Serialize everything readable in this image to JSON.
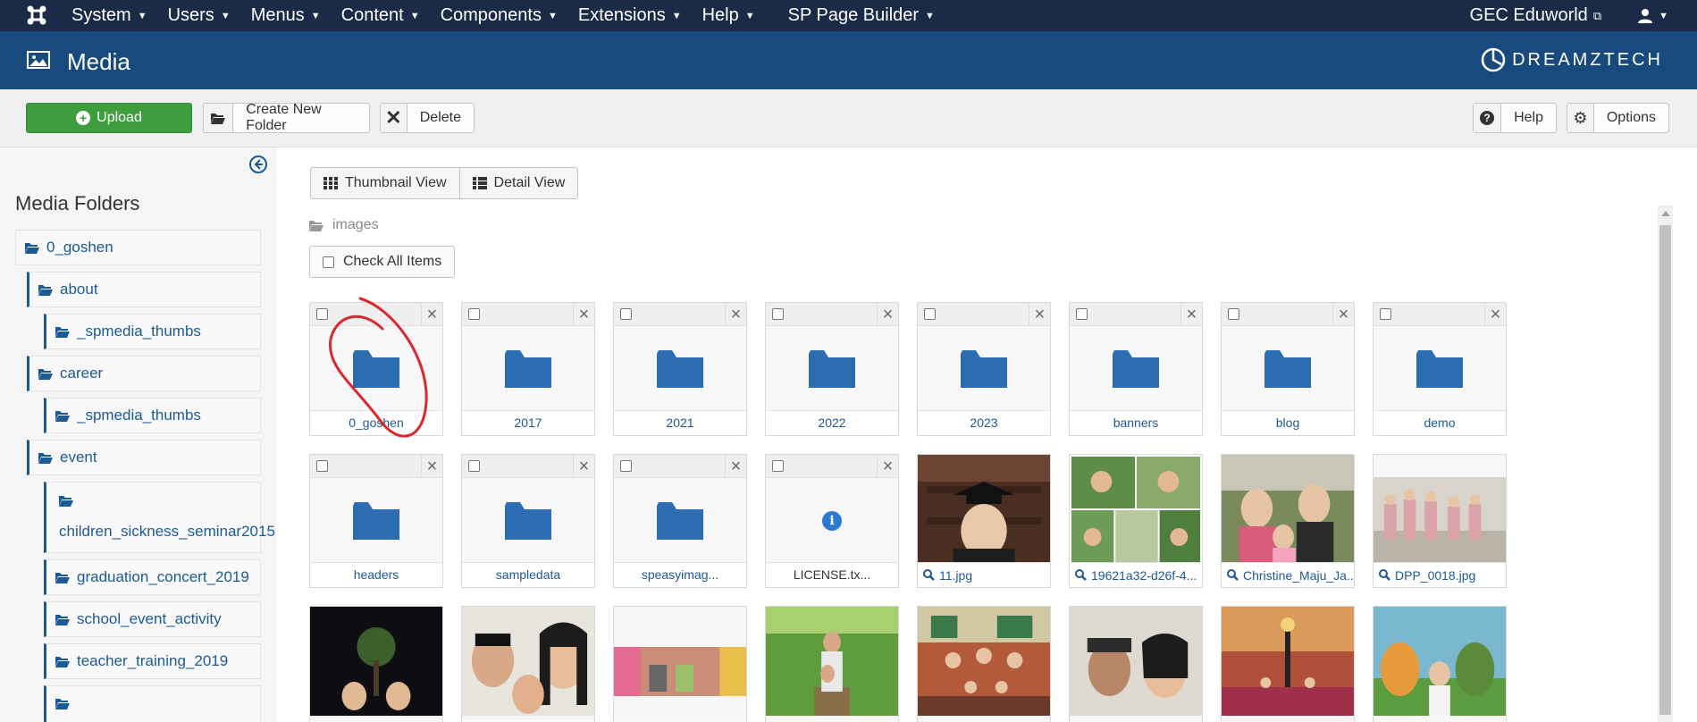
{
  "topnav": {
    "menu": [
      "System",
      "Users",
      "Menus",
      "Content",
      "Components",
      "Extensions",
      "Help"
    ],
    "sp_page_builder": "SP Page Builder",
    "site_name": "GEC Eduworld",
    "user_icon": "user-icon"
  },
  "header": {
    "title": "Media",
    "brand": "DREAMZTECH"
  },
  "toolbar": {
    "upload": "Upload",
    "create_folder": "Create New Folder",
    "delete": "Delete",
    "help": "Help",
    "options": "Options"
  },
  "sidebar": {
    "title": "Media Folders",
    "folders": [
      {
        "label": "0_goshen",
        "level": 0
      },
      {
        "label": "about",
        "level": 1
      },
      {
        "label": "_spmedia_thumbs",
        "level": 2
      },
      {
        "label": "career",
        "level": 1
      },
      {
        "label": "_spmedia_thumbs",
        "level": 2
      },
      {
        "label": "event",
        "level": 1
      },
      {
        "label": "children_sickness_seminar2015",
        "level": 2
      },
      {
        "label": "graduation_concert_2019",
        "level": 2
      },
      {
        "label": "school_event_activity",
        "level": 2
      },
      {
        "label": "teacher_training_2019",
        "level": 2
      },
      {
        "label": "",
        "level": 2
      }
    ]
  },
  "main": {
    "thumbnail_view": "Thumbnail View",
    "detail_view": "Detail View",
    "breadcrumb": "images",
    "check_all": "Check All Items",
    "folders": [
      "0_goshen",
      "2017",
      "2021",
      "2022",
      "2023",
      "banners",
      "blog",
      "demo",
      "headers",
      "sampledata",
      "speasyimag..."
    ],
    "files": [
      "LICENSE.tx..."
    ],
    "images": [
      "11.jpg",
      "19621a32-d26f-4...",
      "Christine_Maju_Ja...",
      "DPP_0018.jpg"
    ]
  },
  "colors": {
    "topnav_bg": "#1a2a47",
    "header_bg": "#184a7d",
    "accent_blue": "#1c5a96",
    "upload_green": "#3e9e3e",
    "annotation_red": "#d9282f"
  }
}
